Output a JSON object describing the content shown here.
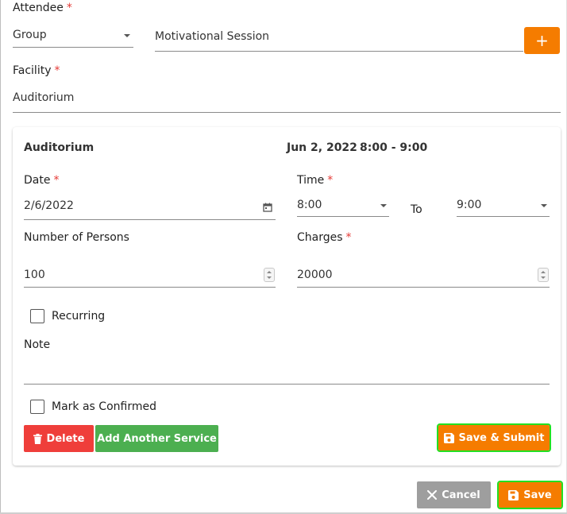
{
  "attendee": {
    "label": "Attendee",
    "required": "*",
    "type_value": "Group",
    "name_value": "Motivational Session",
    "add_label": "+"
  },
  "facility": {
    "label": "Facility",
    "required": "*",
    "value": "Auditorium"
  },
  "booking": {
    "facility_title": "Auditorium",
    "date_summary": "Jun 2, 2022",
    "time_summary": "8:00 - 9:00",
    "date": {
      "label": "Date",
      "required": "*",
      "value": "2/6/2022"
    },
    "time": {
      "label": "Time",
      "required": "*",
      "from": "8:00",
      "to_label": "To",
      "to": "9:00"
    },
    "persons": {
      "label": "Number of Persons",
      "value": "100"
    },
    "charges": {
      "label": "Charges",
      "required": "*",
      "value": "20000"
    },
    "recurring_label": "Recurring",
    "note_label": "Note",
    "note_value": "",
    "confirmed_label": "Mark as Confirmed",
    "delete_label": "Delete",
    "add_service_label": "Add Another Service",
    "save_submit_label": "Save & Submit"
  },
  "footer": {
    "cancel_label": "Cancel",
    "save_label": "Save"
  },
  "colors": {
    "accent_orange": "#f57c00",
    "delete_red": "#ef3e3a",
    "add_green": "#4caf50",
    "cancel_grey": "#9e9e9e",
    "required_red": "#e53935",
    "focus_outline": "#22e022"
  }
}
